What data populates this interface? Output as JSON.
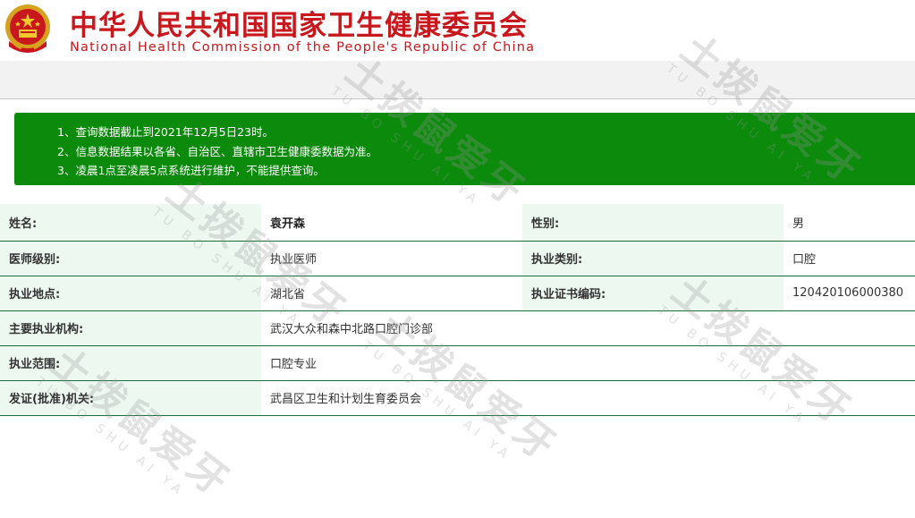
{
  "header": {
    "title_cn": "中华人民共和国国家卫生健康委员会",
    "title_en": "National Health Commission of the People's Republic of China",
    "emblem_icon": "national-emblem-icon"
  },
  "notice": {
    "lines": [
      "1、查询数据截止到2021年12月5日23时。",
      "2、信息数据结果以各省、自治区、直辖市卫生健康委数据为准。",
      "3、凌晨1点至凌晨5点系统进行维护，不能提供查询。"
    ]
  },
  "record": {
    "name_label": "姓名:",
    "name_value": "袁开森",
    "gender_label": "性别:",
    "gender_value": "男",
    "level_label": "医师级别:",
    "level_value": "执业医师",
    "category_label": "执业类别:",
    "category_value": "口腔",
    "location_label": "执业地点:",
    "location_value": "湖北省",
    "cert_label": "执业证书编码:",
    "cert_value": "120420106000380",
    "institution_label": "主要执业机构:",
    "institution_value": "武汉大众和森中北路口腔门诊部",
    "scope_label": "执业范围:",
    "scope_value": "口腔专业",
    "issuer_label": "发证(批准)机关:",
    "issuer_value": "武昌区卫生和计划生育委员会"
  },
  "watermark": {
    "text_cn": "土拨鼠爱牙",
    "text_en": "TU BO SHU AI YA"
  },
  "colors": {
    "brand_red": "#c8171d",
    "notice_green": "#0c8a0c",
    "label_bg": "#edf8f1",
    "row_border": "#1d6b3a"
  }
}
